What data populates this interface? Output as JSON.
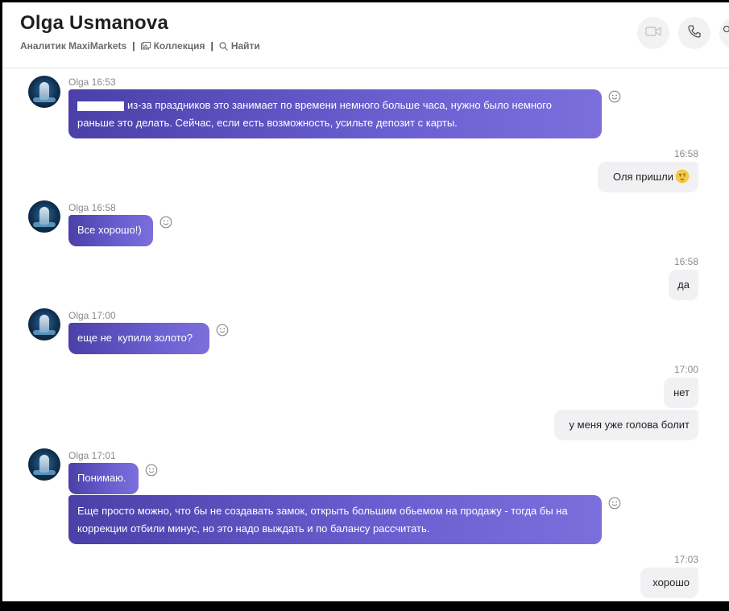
{
  "header": {
    "title": "Olga Usmanova",
    "subtitle": "Аналитик MaxiMarkets",
    "separator": "|",
    "collection_label": "Коллекция",
    "search_label": "Найти"
  },
  "messages": [
    {
      "sender": "Olga",
      "time": "16:53",
      "meta": "Olga 16:53",
      "lines": [
        "из-за праздников это занимает по времени немного больше часа, нужно было немного",
        "раньше это делать. Сейчас, если есть возможность, усильте депозит с карты."
      ]
    },
    {
      "time": "16:58",
      "text": "Оля пришли"
    },
    {
      "sender": "Olga",
      "time": "16:58",
      "meta": "Olga 16:58",
      "text": "Все хорошо!)"
    },
    {
      "time": "16:58",
      "text": "да"
    },
    {
      "sender": "Olga",
      "time": "17:00",
      "meta": "Olga 17:00",
      "text": "еще не  купили золото?"
    },
    {
      "time": "17:00",
      "text": "нет"
    },
    {
      "text": "у меня уже голова болит"
    },
    {
      "sender": "Olga",
      "time": "17:01",
      "meta": "Olga 17:01",
      "text": "Понимаю."
    },
    {
      "lines": [
        "Еще просто можно, что бы не создавать замок, открыть большим обьемом на продажу - тогда бы на",
        "коррекции отбили минус, но это надо выждать и по балансу рассчитать."
      ]
    },
    {
      "time": "17:03",
      "text": "хорошо"
    }
  ],
  "icons": [
    "video-call-icon",
    "voice-call-icon",
    "add-contact-icon",
    "collection-icon",
    "search-icon",
    "react-smiley-icon",
    "avatar",
    "thinking-emoji-icon"
  ],
  "colors": {
    "bubble_in_start": "#4b3fa8",
    "bubble_in_end": "#7c6fdc",
    "bubble_out": "#f1f1f3"
  }
}
